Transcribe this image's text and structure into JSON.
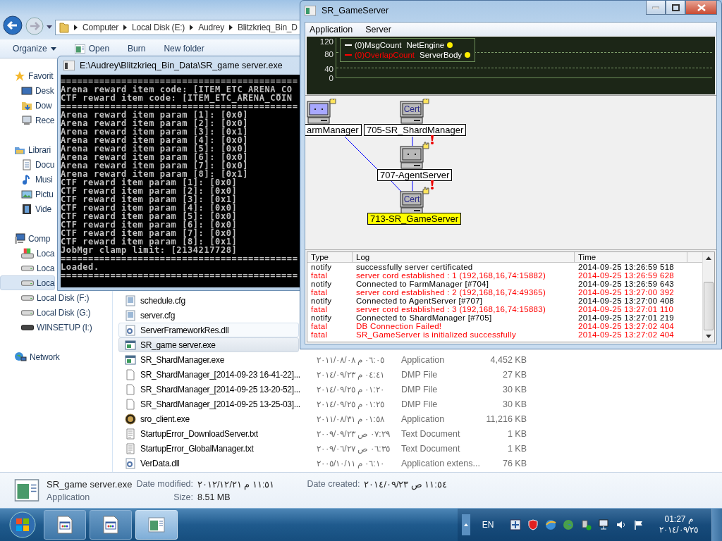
{
  "explorer": {
    "breadcrumbs": [
      "Computer",
      "Local Disk (E:)",
      "Audrey",
      "Blitzkrieq_Bin_D"
    ],
    "toolbar": [
      "Organize",
      "Open",
      "Burn",
      "New folder"
    ],
    "nav": [
      {
        "label": "Favorit",
        "kind": "star",
        "selected": false,
        "children": [
          {
            "label": "Desk",
            "kind": "desktop",
            "selected": false
          },
          {
            "label": "Dow",
            "kind": "download",
            "selected": false
          },
          {
            "label": "Rece",
            "kind": "recent",
            "selected": false
          }
        ]
      },
      {
        "label": "Librari",
        "kind": "library",
        "selected": false,
        "children": [
          {
            "label": "Docu",
            "kind": "document",
            "selected": false
          },
          {
            "label": "Musi",
            "kind": "music",
            "selected": false
          },
          {
            "label": "Pictu",
            "kind": "picture",
            "selected": false
          },
          {
            "label": "Vide",
            "kind": "video",
            "selected": false
          }
        ]
      },
      {
        "label": "Comp",
        "kind": "computer",
        "selected": false,
        "children": [
          {
            "label": "Loca",
            "kind": "sysdisk",
            "selected": false
          },
          {
            "label": "Loca",
            "kind": "disk",
            "selected": false
          },
          {
            "label": "Loca",
            "kind": "disk",
            "selected": true
          },
          {
            "label": "Local Disk (F:)",
            "kind": "disk",
            "selected": false
          },
          {
            "label": "Local Disk (G:)",
            "kind": "disk",
            "selected": false
          },
          {
            "label": "WINSETUP (I:)",
            "kind": "usb",
            "selected": false
          }
        ]
      },
      {
        "label": "Network",
        "kind": "network",
        "selected": false
      }
    ],
    "files": [
      {
        "name": "schedule.cfg",
        "kind": "cfg",
        "selected": false,
        "hovered": false
      },
      {
        "name": "server.cfg",
        "kind": "cfg",
        "selected": false,
        "hovered": false
      },
      {
        "name": "ServerFrameworkRes.dll",
        "kind": "dll",
        "selected": false,
        "hovered": true
      },
      {
        "name": "SR_game server.exe",
        "kind": "exe",
        "selected": true,
        "hovered": false
      },
      {
        "name": "SR_ShardManager.exe",
        "kind": "exe",
        "selected": false,
        "hovered": false,
        "date": "٢٠١١/٠٨/٠٨ م ٠٦:٠٥",
        "type": "Application",
        "size": "4,452 KB"
      },
      {
        "name": "SR_ShardManager_[2014-09-23 16-41-22]...",
        "kind": "blank",
        "selected": false,
        "hovered": false,
        "date": "٢٠١٤/٠٩/٢٣ م ٠٤:٤١",
        "type": "DMP File",
        "size": "27 KB"
      },
      {
        "name": "SR_ShardManager_[2014-09-25 13-20-52]...",
        "kind": "blank",
        "selected": false,
        "hovered": false,
        "date": "٢٠١٤/٠٩/٢٥ م ٠١:٢٠",
        "type": "DMP File",
        "size": "30 KB"
      },
      {
        "name": "SR_ShardManager_[2014-09-25 13-25-03]...",
        "kind": "blank",
        "selected": false,
        "hovered": false,
        "date": "٢٠١٤/٠٩/٢٥ م ٠١:٢٥",
        "type": "DMP File",
        "size": "30 KB"
      },
      {
        "name": "sro_client.exe",
        "kind": "game",
        "selected": false,
        "hovered": false,
        "date": "٢٠١١/٠٨/٣١ م ٠١:٥٨",
        "type": "Application",
        "size": "11,216 KB"
      },
      {
        "name": "StartupError_DownloadServer.txt",
        "kind": "txt",
        "selected": false,
        "hovered": false,
        "date": "٢٠٠٩/٠٩/٢٣ ص ٠٧:٢٩",
        "type": "Text Document",
        "size": "1 KB"
      },
      {
        "name": "StartupError_GlobalManager.txt",
        "kind": "txt",
        "selected": false,
        "hovered": false,
        "date": "٢٠٠٩/٠٦/٢٧ ص ٠٦:٣٥",
        "type": "Text Document",
        "size": "1 KB"
      },
      {
        "name": "VerData.dll",
        "kind": "dll",
        "selected": false,
        "hovered": false,
        "date": "٢٠٠٥/١٠/١١ م ٠٦:١٠",
        "type": "Application extens...",
        "size": "76 KB"
      }
    ],
    "details": {
      "name": "SR_game server.exe",
      "type": "Application",
      "modified_label": "Date modified:",
      "modified": "٢٠١٢/١٢/٢١ م ١١:٥١",
      "created_label": "Date created:",
      "created": "٢٠١٤/٠٩/٢٣ ص ١١:٥٤",
      "size_label": "Size:",
      "size": "8.51 MB"
    }
  },
  "console": {
    "title": "E:\\Audrey\\Blitzkrieq_Bin_Data\\SR_game server.exe",
    "lines": [
      "===========================================",
      "Arena reward item code: [ITEM_ETC_ARENA_CO",
      "CTF reward item code: [ITEM_ETC_ARENA_COIN",
      "===========================================",
      "Arena reward item param [1]: [0x0]",
      "Arena reward item param [2]: [0x0]",
      "Arena reward item param [3]: [0x1]",
      "Arena reward item param [4]: [0x0]",
      "Arena reward item param [5]: [0x0]",
      "Arena reward item param [6]: [0x0]",
      "Arena reward item param [7]: [0x0]",
      "Arena reward item param [8]: [0x1]",
      "CTF reward item param [1]: [0x0]",
      "CTF reward item param [2]: [0x0]",
      "CTF reward item param [3]: [0x1]",
      "CTF reward item param [4]: [0x0]",
      "CTF reward item param [5]: [0x0]",
      "CTF reward item param [6]: [0x0]",
      "CTF reward item param [7]: [0x0]",
      "CTF reward item param [8]: [0x1]",
      "JobMgr clamp limit: [2134217728]",
      "===========================================",
      "Loaded.",
      "==========================================="
    ]
  },
  "server": {
    "title": "SR_GameServer",
    "menu": [
      "Application",
      "Server"
    ],
    "monitor": {
      "axis_labels": [
        "120",
        "80",
        "40",
        "0"
      ],
      "legend": [
        {
          "counter": "(0)MsgCount",
          "source": "NetEngine",
          "color": "#ffffff"
        },
        {
          "counter": "(0)OverlapCount",
          "source": "ServerBody",
          "color": "#ff0000"
        }
      ]
    },
    "nodes": [
      {
        "label": "armManager",
        "active": true,
        "alert": false,
        "selected": false
      },
      {
        "label": "705-SR_ShardManager",
        "screen": "Cert",
        "active": false,
        "alert": false,
        "selected": false
      },
      {
        "label": "707-AgentServer",
        "active": false,
        "alert": true,
        "selected": false
      },
      {
        "label": "713-SR_GameServer",
        "screen": "Cert",
        "active": false,
        "alert": true,
        "selected": true
      }
    ],
    "log": {
      "columns": [
        "Type",
        "Log",
        "Time"
      ],
      "rows": [
        {
          "type": "notify",
          "message": "successfully server certificated",
          "time": "2014-09-25 13:26:59 518",
          "kind": "info"
        },
        {
          "type": "fatal",
          "message": "server cord established : 1 (192,168,16,74:15882)",
          "time": "2014-09-25 13:26:59 628",
          "kind": "error"
        },
        {
          "type": "notify",
          "message": "Connected to FarmManager [#704]",
          "time": "2014-09-25 13:26:59 643",
          "kind": "info"
        },
        {
          "type": "fatal",
          "message": "server cord established : 2 (192,168,16,74:49365)",
          "time": "2014-09-25 13:27:00 392",
          "kind": "error"
        },
        {
          "type": "notify",
          "message": "Connected to AgentServer [#707]",
          "time": "2014-09-25 13:27:00 408",
          "kind": "info"
        },
        {
          "type": "fatal",
          "message": "server cord established : 3 (192,168,16,74:15883)",
          "time": "2014-09-25 13:27:01 110",
          "kind": "error"
        },
        {
          "type": "notify",
          "message": "Connected to ShardManager [#705]",
          "time": "2014-09-25 13:27:01 219",
          "kind": "info"
        },
        {
          "type": "fatal",
          "message": "DB Connection Failed!",
          "time": "2014-09-25 13:27:02 404",
          "kind": "error"
        },
        {
          "type": "fatal",
          "message": "SR_GameServer is initialized successfully",
          "time": "2014-09-25 13:27:02 404",
          "kind": "error"
        }
      ]
    }
  },
  "taskbar": {
    "buttons": [
      {
        "selected": false
      },
      {
        "selected": false
      },
      {
        "selected": true
      }
    ],
    "language": "EN",
    "time": "01:27 م",
    "date": "٢٠١٤/٠٩/٢٥"
  }
}
